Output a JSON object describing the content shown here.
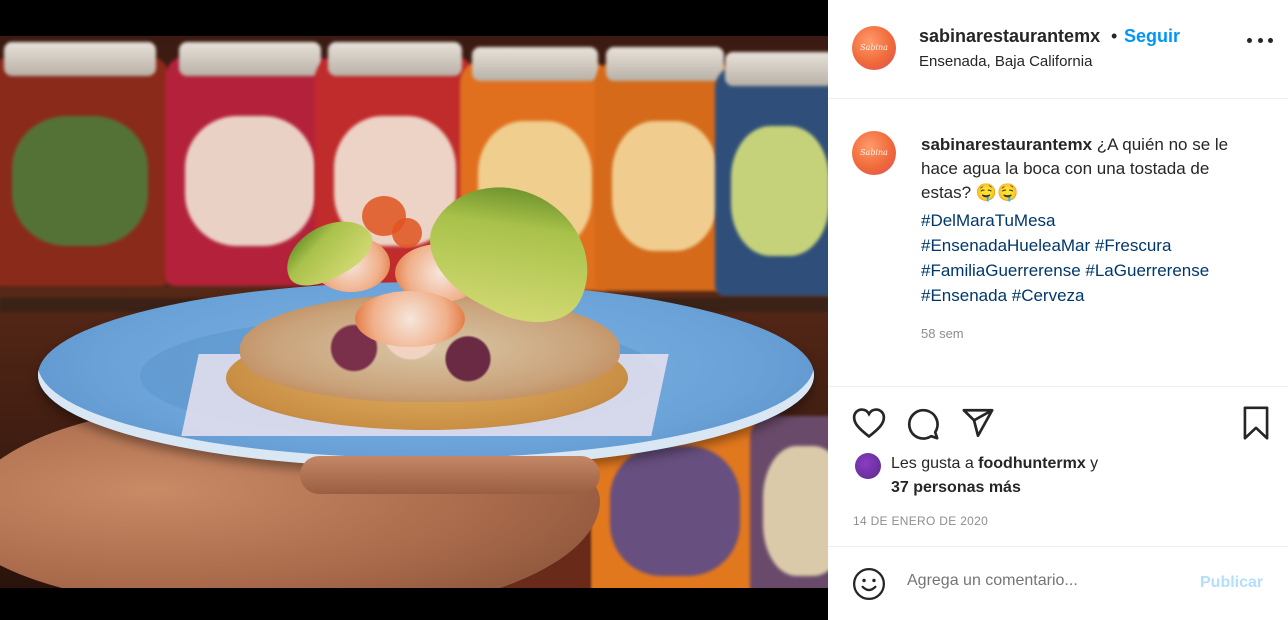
{
  "post": {
    "username": "sabinarestaurantemx",
    "separator": "•",
    "follow_label": "Seguir",
    "location": "Ensenada, Baja California",
    "more_icon": "more-options-icon"
  },
  "caption": {
    "username": "sabinarestaurantemx",
    "text": "¿A quién no se le hace agua la boca con una tostada de estas? 🤤🤤",
    "hashtags": [
      "#DelMaraTuMesa",
      "#EnsenadaHueleaMar #Frescura",
      "#FamiliaGuerrerense #LaGuerrerense",
      "#Ensenada #Cerveza"
    ],
    "time": "58 sem"
  },
  "actions": {
    "like_icon": "heart-icon",
    "comment_icon": "comment-icon",
    "share_icon": "share-icon",
    "save_icon": "bookmark-icon"
  },
  "likes": {
    "prefix": "Les gusta a ",
    "user": "foodhuntermx",
    "suffix": " y",
    "others": "37 personas más"
  },
  "date": "14 DE ENERO DE 2020",
  "comment": {
    "placeholder": "Agrega un comentario...",
    "publish_label": "Publicar",
    "emoji_icon": "emoji-icon"
  },
  "colors": {
    "link_blue": "#0095f6",
    "hashtag_blue": "#00376b",
    "muted": "#8e8e8e",
    "publish_disabled": "#b2dffc"
  }
}
